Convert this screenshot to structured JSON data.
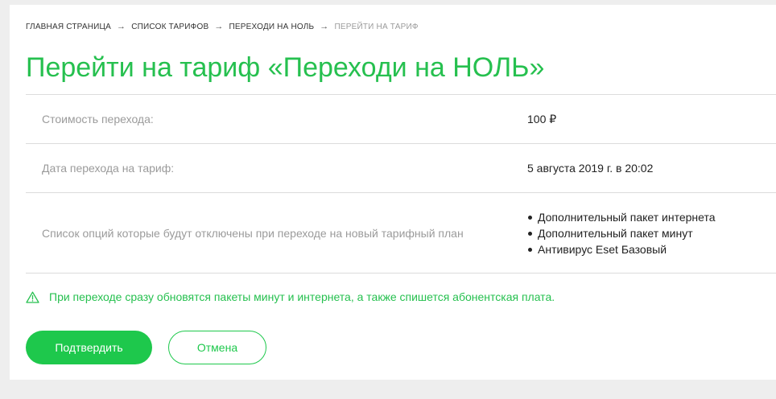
{
  "breadcrumb": {
    "items": [
      "ГЛАВНАЯ СТРАНИЦА",
      "СПИСОК ТАРИФОВ",
      "ПЕРЕХОДИ НА НОЛЬ"
    ],
    "current": "ПЕРЕЙТИ НА ТАРИФ",
    "separator": "→"
  },
  "page": {
    "title": "Перейти на тариф «Переходи на НОЛЬ»"
  },
  "details": {
    "cost_label": "Стоимость перехода:",
    "cost_value": "100 ₽",
    "date_label": "Дата перехода на тариф:",
    "date_value": "5 августа 2019 г. в 20:02",
    "options_label": "Список опций которые будут отключены при переходе на новый тарифный план",
    "options": [
      "Дополнительный пакет интернета",
      "Дополнительный пакет минут",
      "Антивирус Eset Базовый"
    ]
  },
  "notice": {
    "icon": "warning-triangle-icon",
    "text": "При переходе сразу обновятся пакеты минут и интернета, а также спишется абонентская плата."
  },
  "actions": {
    "confirm_label": "Подтвердить",
    "cancel_label": "Отмена"
  },
  "colors": {
    "brand_green": "#1ec84c",
    "title_green": "#26c04f",
    "label_gray": "#9b9b9b",
    "background": "#eeeeee"
  }
}
